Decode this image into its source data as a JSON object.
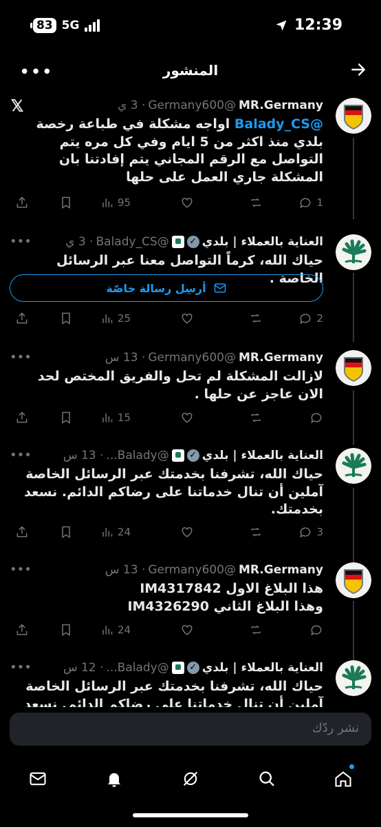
{
  "status_bar": {
    "battery": "83",
    "network": "5G",
    "time": "12:39"
  },
  "header": {
    "title": "المنشور",
    "more": "•••"
  },
  "tweets": [
    {
      "name": "MR.Germany",
      "handle": "@Germany600",
      "time": "· 3 ي",
      "mention": "@Balady_CS",
      "body_rest": " اواجه مشكلة في طباعة رخصة بلدي منذ اكثر من 5 ايام وفي كل مره يتم التواصل مع الرقم المجاني يتم إفادتنا بان المشكلة جاري العمل على حلها",
      "replies": "1",
      "views": "95"
    },
    {
      "name": "العناية بالعملاء | بلدي",
      "handle": "@Balady_CS",
      "time": "· 3 ي",
      "body": "حياك الله، كرماً التواصل معنا عبر الرسائل الخاصة .",
      "button": "أرسِل رسالة خاصّة",
      "replies": "2",
      "views": "25"
    },
    {
      "name": "MR.Germany",
      "handle": "@Germany600",
      "time": "· 13 س",
      "body": "لازالت المشكلة لم تحل والفريق المختص لحد الان عاجز عن حلها .",
      "replies": "",
      "views": "15"
    },
    {
      "name": "العناية بالعملاء | بلدي",
      "handle": "@Balady...",
      "time": "· 13 س",
      "body": "حياك الله، تشرفنا بخدمتك عبر الرسائل الخاصة آملين أن تنال خدماتنا على رضاكم الدائم. نسعد بخدمتك.",
      "replies": "3",
      "views": "24"
    },
    {
      "name": "MR.Germany",
      "handle": "@Germany600",
      "time": "· 13 س",
      "body_line1": "هذا البلاغ الاول IM4317842",
      "body_line2": "وهذا البلاغ الثاني IM4326290",
      "replies": "",
      "views": "24"
    },
    {
      "name": "العناية بالعملاء | بلدي",
      "handle": "@Balady...",
      "time": "· 12 س",
      "body": "حياك الله، تشرفنا بخدمتك عبر الرسائل الخاصة آملين أن تنال خدماتنا على رضاكم الدائم. نسعد بخدمتك."
    }
  ],
  "reply_bar": {
    "placeholder": "نشر ردّك"
  },
  "colors": {
    "accent": "#1d9bf0",
    "muted": "#71767b",
    "bg": "#000000"
  }
}
